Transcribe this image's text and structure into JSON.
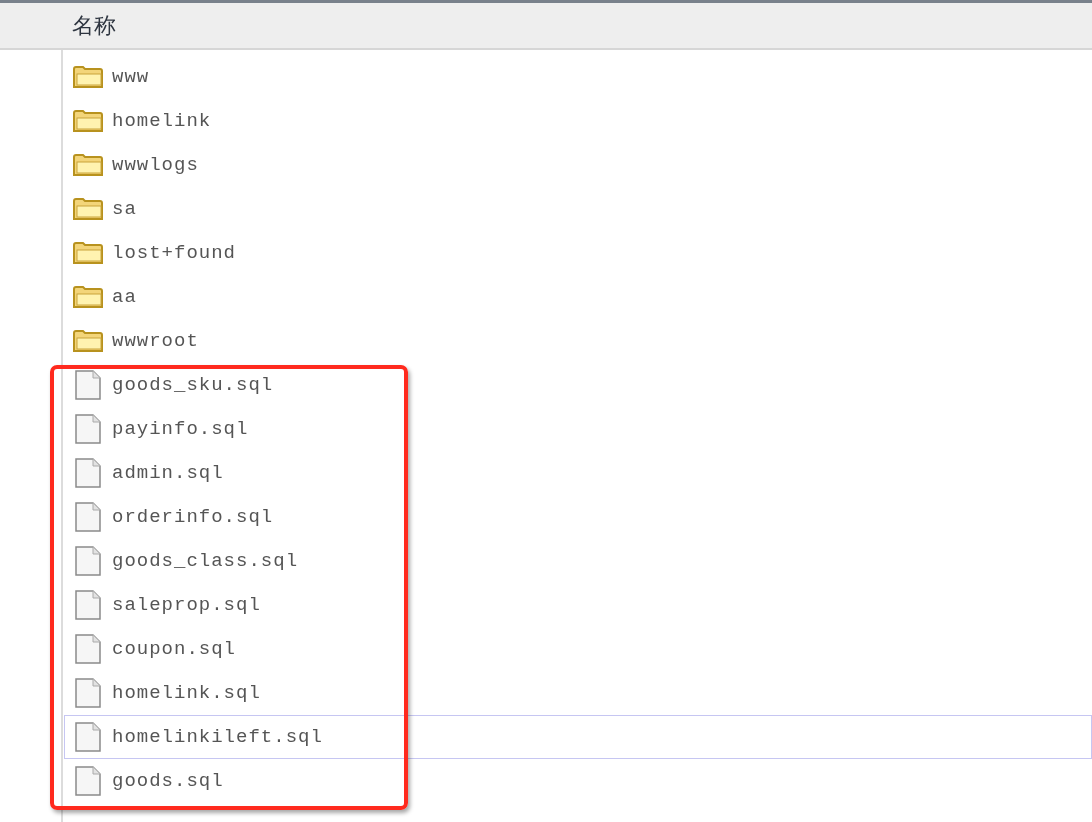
{
  "columns": [
    {
      "label": "名称"
    }
  ],
  "files": [
    {
      "kind": "folder",
      "name": "www",
      "selected": false
    },
    {
      "kind": "folder",
      "name": "homelink",
      "selected": false
    },
    {
      "kind": "folder",
      "name": "wwwlogs",
      "selected": false
    },
    {
      "kind": "folder",
      "name": "sa",
      "selected": false
    },
    {
      "kind": "folder",
      "name": "lost+found",
      "selected": false
    },
    {
      "kind": "folder",
      "name": "aa",
      "selected": false
    },
    {
      "kind": "folder",
      "name": "wwwroot",
      "selected": false
    },
    {
      "kind": "file",
      "name": "goods_sku.sql",
      "selected": false
    },
    {
      "kind": "file",
      "name": "payinfo.sql",
      "selected": false
    },
    {
      "kind": "file",
      "name": "admin.sql",
      "selected": false
    },
    {
      "kind": "file",
      "name": "orderinfo.sql",
      "selected": false
    },
    {
      "kind": "file",
      "name": "goods_class.sql",
      "selected": false
    },
    {
      "kind": "file",
      "name": "saleprop.sql",
      "selected": false
    },
    {
      "kind": "file",
      "name": "coupon.sql",
      "selected": false
    },
    {
      "kind": "file",
      "name": "homelink.sql",
      "selected": false
    },
    {
      "kind": "file",
      "name": "homelinkileft.sql",
      "selected": true
    },
    {
      "kind": "file",
      "name": "goods.sql",
      "selected": false
    }
  ]
}
